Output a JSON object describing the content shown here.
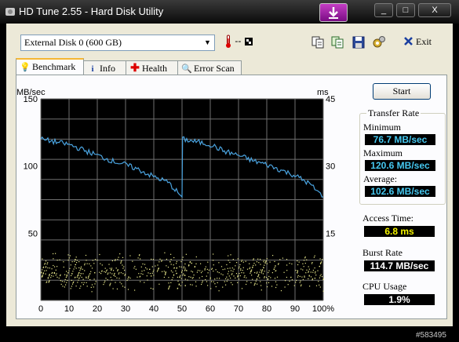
{
  "window": {
    "title": "HD Tune 2.55 - Hard Disk Utility",
    "controls": [
      "_",
      "□",
      "X"
    ]
  },
  "toolbar": {
    "drive": "External Disk 0 (600 GB)",
    "temperature": "--",
    "exit_label": "Exit"
  },
  "tabs": [
    {
      "label": "Benchmark",
      "icon": "lightbulb-icon"
    },
    {
      "label": "Info",
      "icon": "info-icon"
    },
    {
      "label": "Health",
      "icon": "health-cross-icon"
    },
    {
      "label": "Error Scan",
      "icon": "magnifier-icon"
    }
  ],
  "chart": {
    "left_unit": "MB/sec",
    "right_unit": "ms",
    "left_ticks": [
      "150",
      "100",
      "50"
    ],
    "right_ticks": [
      "45",
      "30",
      "15"
    ],
    "x_ticks": [
      "0",
      "10",
      "20",
      "30",
      "40",
      "50",
      "60",
      "70",
      "80",
      "90",
      "100%"
    ]
  },
  "chart_data": {
    "type": "line",
    "ylim": [
      0,
      150
    ],
    "y2lim": [
      0,
      45
    ],
    "xlim": [
      0,
      100
    ],
    "series": [
      {
        "axis": "left",
        "color": "#4aa3df",
        "x": [
          0,
          5,
          10,
          15,
          20,
          25,
          30,
          35,
          40,
          45,
          50,
          50.2,
          55,
          60,
          65,
          70,
          75,
          80,
          85,
          90,
          95,
          100
        ],
        "y": [
          120,
          118,
          116,
          112,
          108,
          104,
          101,
          97,
          92,
          88,
          77,
          120,
          118,
          116,
          111,
          108,
          104,
          101,
          97,
          93,
          87,
          77
        ]
      },
      {
        "axis": "right",
        "type": "scatter",
        "color": "#e8e88a",
        "x_range": [
          0,
          100
        ],
        "y_range_ms": [
          2,
          11
        ]
      }
    ],
    "colors": {
      "background": "#000000",
      "grid": "#6f6f6f"
    }
  },
  "side": {
    "start_label": "Start",
    "group_title": "Transfer Rate",
    "minimum_label": "Minimum",
    "minimum_value": "76.7 MB/sec",
    "maximum_label": "Maximum",
    "maximum_value": "120.6 MB/sec",
    "average_label": "Average:",
    "average_value": "102.6 MB/sec",
    "access_label": "Access Time:",
    "access_value": "6.8 ms",
    "burst_label": "Burst Rate",
    "burst_value": "114.7 MB/sec",
    "cpu_label": "CPU Usage",
    "cpu_value": "1.9%",
    "colors": {
      "cyan": "#45c8f0",
      "yellow": "#f5f500",
      "white": "#ffffff"
    }
  },
  "watermark": "#583495"
}
